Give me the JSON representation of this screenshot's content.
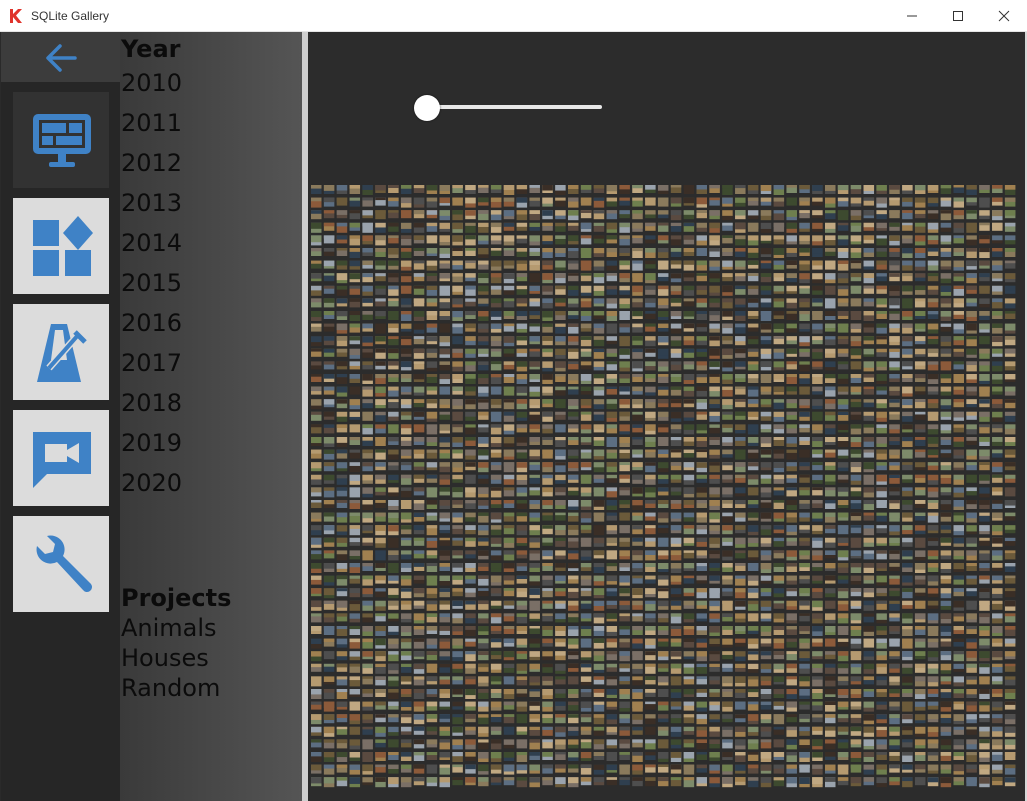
{
  "window": {
    "title": "SQLite Gallery",
    "logo_icon": "kdenlive-k-logo",
    "logo_color": "#e0332b",
    "controls": [
      "minimize-icon",
      "maximize-icon",
      "close-icon"
    ]
  },
  "rail": {
    "back_icon": "arrow-left-icon",
    "accent_color": "#3f82c6",
    "items": [
      {
        "icon": "monitor-dashboard-icon",
        "active": true
      },
      {
        "icon": "shapes-grid-icon",
        "active": false
      },
      {
        "icon": "metronome-icon",
        "active": false
      },
      {
        "icon": "video-chat-icon",
        "active": false
      },
      {
        "icon": "wrench-icon",
        "active": false
      }
    ]
  },
  "filters": {
    "year_title": "Year",
    "years": [
      "2010",
      "2011",
      "2012",
      "2013",
      "2014",
      "2015",
      "2016",
      "2017",
      "2018",
      "2019",
      "2020"
    ],
    "projects_title": "Projects",
    "projects": [
      "Animals",
      "Houses",
      "Random"
    ]
  },
  "gallery": {
    "zoom_slider_value": 0,
    "thumbnail_palette": [
      "#6b5a3a",
      "#8a7a5c",
      "#3d4a2f",
      "#7a6f66",
      "#5c6e82",
      "#a08050",
      "#4e4e4e",
      "#b59a70",
      "#2f3f4f",
      "#8c5a3a",
      "#6e7f4e",
      "#9aa3ad",
      "#c0a882",
      "#3a2e26",
      "#7d8b6a",
      "#5a4a40"
    ]
  }
}
